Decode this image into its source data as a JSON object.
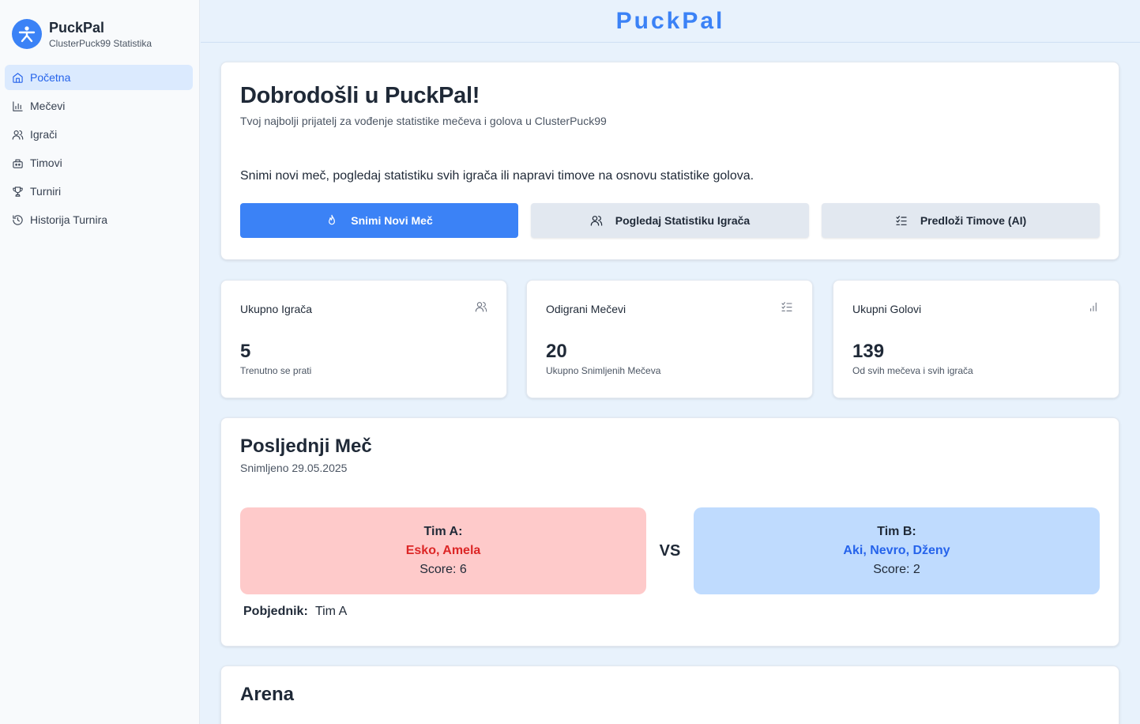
{
  "brand": {
    "name": "PuckPal",
    "subtitle": "ClusterPuck99 Statistika"
  },
  "sidebar": {
    "items": [
      {
        "label": "Početna",
        "icon": "home-icon",
        "active": true
      },
      {
        "label": "Mečevi",
        "icon": "bar-chart-icon",
        "active": false
      },
      {
        "label": "Igrači",
        "icon": "users-icon",
        "active": false
      },
      {
        "label": "Timovi",
        "icon": "team-icon",
        "active": false
      },
      {
        "label": "Turniri",
        "icon": "trophy-icon",
        "active": false
      },
      {
        "label": "Historija Turnira",
        "icon": "history-icon",
        "active": false
      }
    ]
  },
  "header": {
    "title": "PuckPal"
  },
  "welcome": {
    "title": "Dobrodošli u PuckPal!",
    "subtitle": "Tvoj najbolji prijatelj za vođenje statistike mečeva i golova u ClusterPuck99",
    "description": "Snimi novi meč, pogledaj statistiku svih igrača ili napravi timove na osnovu statistike golova.",
    "buttons": {
      "record": "Snimi Novi Meč",
      "stats": "Pogledaj Statistiku Igrača",
      "suggest": "Predloži Timove (AI)"
    }
  },
  "stats": [
    {
      "label": "Ukupno Igrača",
      "value": "5",
      "note": "Trenutno se prati",
      "icon": "users-icon"
    },
    {
      "label": "Odigrani Mečevi",
      "value": "20",
      "note": "Ukupno Snimljenih Mečeva",
      "icon": "list-check-icon"
    },
    {
      "label": "Ukupni Golovi",
      "value": "139",
      "note": "Od svih mečeva i svih igrača",
      "icon": "bar-chart-icon"
    }
  ],
  "last_match": {
    "title": "Posljednji Meč",
    "date": "Snimljeno 29.05.2025",
    "team_a": {
      "title": "Tim A:",
      "players": "Esko, Amela",
      "score": "Score: 6"
    },
    "vs": "VS",
    "team_b": {
      "title": "Tim B:",
      "players": "Aki, Nevro, Dženy",
      "score": "Score: 2"
    },
    "winner_label": "Pobjednik:",
    "winner_value": "Tim A"
  },
  "arena": {
    "title": "Arena"
  },
  "colors": {
    "accent": "#3b82f6",
    "team_a_bg": "#fecaca",
    "team_b_bg": "#bfdbfe",
    "team_a_text": "#dc2626",
    "team_b_text": "#2563eb"
  }
}
